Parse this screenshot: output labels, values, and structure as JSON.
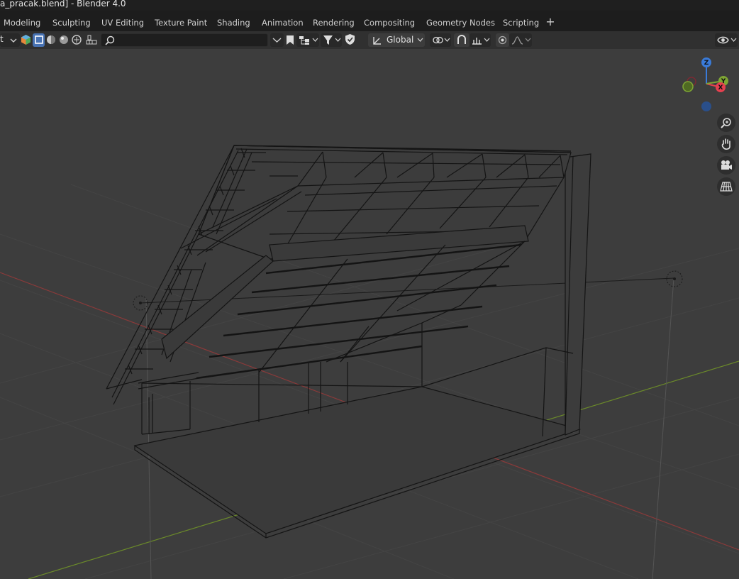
{
  "window": {
    "title": "a_pracak.blend] - Blender 4.0"
  },
  "workspace_tabs": [
    {
      "label": "Modeling"
    },
    {
      "label": "Sculpting"
    },
    {
      "label": "UV Editing"
    },
    {
      "label": "Texture Paint"
    },
    {
      "label": "Shading"
    },
    {
      "label": "Animation"
    },
    {
      "label": "Rendering"
    },
    {
      "label": "Compositing"
    },
    {
      "label": "Geometry Nodes"
    },
    {
      "label": "Scripting"
    }
  ],
  "toolbar": {
    "mode_cut_text": "t",
    "search": {
      "value": "",
      "placeholder": ""
    },
    "transform_orientation": "Global",
    "icons": [
      "mesh-select-icon",
      "vertex-select-icon",
      "solid-shading-icon",
      "material-shading-icon",
      "rendered-shading-icon",
      "brush-icon",
      "search-icon",
      "chevron-down-icon",
      "bookmark-icon",
      "hierarchy-icon",
      "filter-icon",
      "shield-icon",
      "pivot-icon",
      "snap-icon",
      "proportional-icon",
      "falloff-icon",
      "visibility-icon"
    ]
  },
  "gizmo": {
    "axis_z": "Z",
    "axis_y": "Y",
    "axis_x": "X",
    "colors": {
      "x": "#e5404f",
      "y": "#7ea534",
      "z": "#3a7bd8"
    }
  },
  "nav_buttons": [
    "zoom-icon",
    "hand-pan-icon",
    "camera-icon",
    "grid-perspective-icon"
  ],
  "colors": {
    "viewport_bg": "#3d3d3d",
    "x_axis_line": "#8a3a3a",
    "y_axis_line": "#6b8a2a",
    "wire": "#141414",
    "accent": "#4772b3"
  }
}
